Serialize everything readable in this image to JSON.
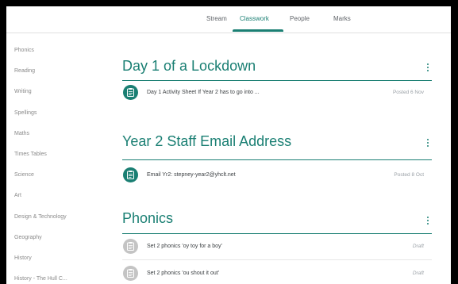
{
  "tabs": {
    "stream": "Stream",
    "classwork": "Classwork",
    "people": "People",
    "marks": "Marks"
  },
  "sidebar": {
    "items": [
      "Phonics",
      "Reading",
      "Writing",
      "Spellings",
      "Maths",
      "Times Tables",
      "Science",
      "Art",
      "Design & Technology",
      "Geography",
      "History",
      "History - The Hull C..."
    ]
  },
  "sections": [
    {
      "title": "Day 1 of a Lockdown",
      "items": [
        {
          "title": "Day 1 Activity Sheet If Year 2 has to go into ...",
          "status": "Posted 6 Nov"
        }
      ]
    },
    {
      "title": "Year 2 Staff Email Address",
      "items": [
        {
          "title": "Email Yr2: stepney-year2@yhclt.net",
          "status": "Posted 8 Oct"
        }
      ]
    },
    {
      "title": "Phonics",
      "items": [
        {
          "title": "Set 2 phonics 'oy toy for a boy'",
          "status": "Draft"
        },
        {
          "title": "Set 2 phonics 'ou shout it out'",
          "status": "Draft"
        }
      ]
    }
  ],
  "colors": {
    "accent": "#1a7f73",
    "draft_icon": "#c4c4c4",
    "muted_text": "#8a8a8a"
  },
  "icons": {
    "item_icon": "assignment-icon",
    "section_menu": "more-vert-icon"
  }
}
